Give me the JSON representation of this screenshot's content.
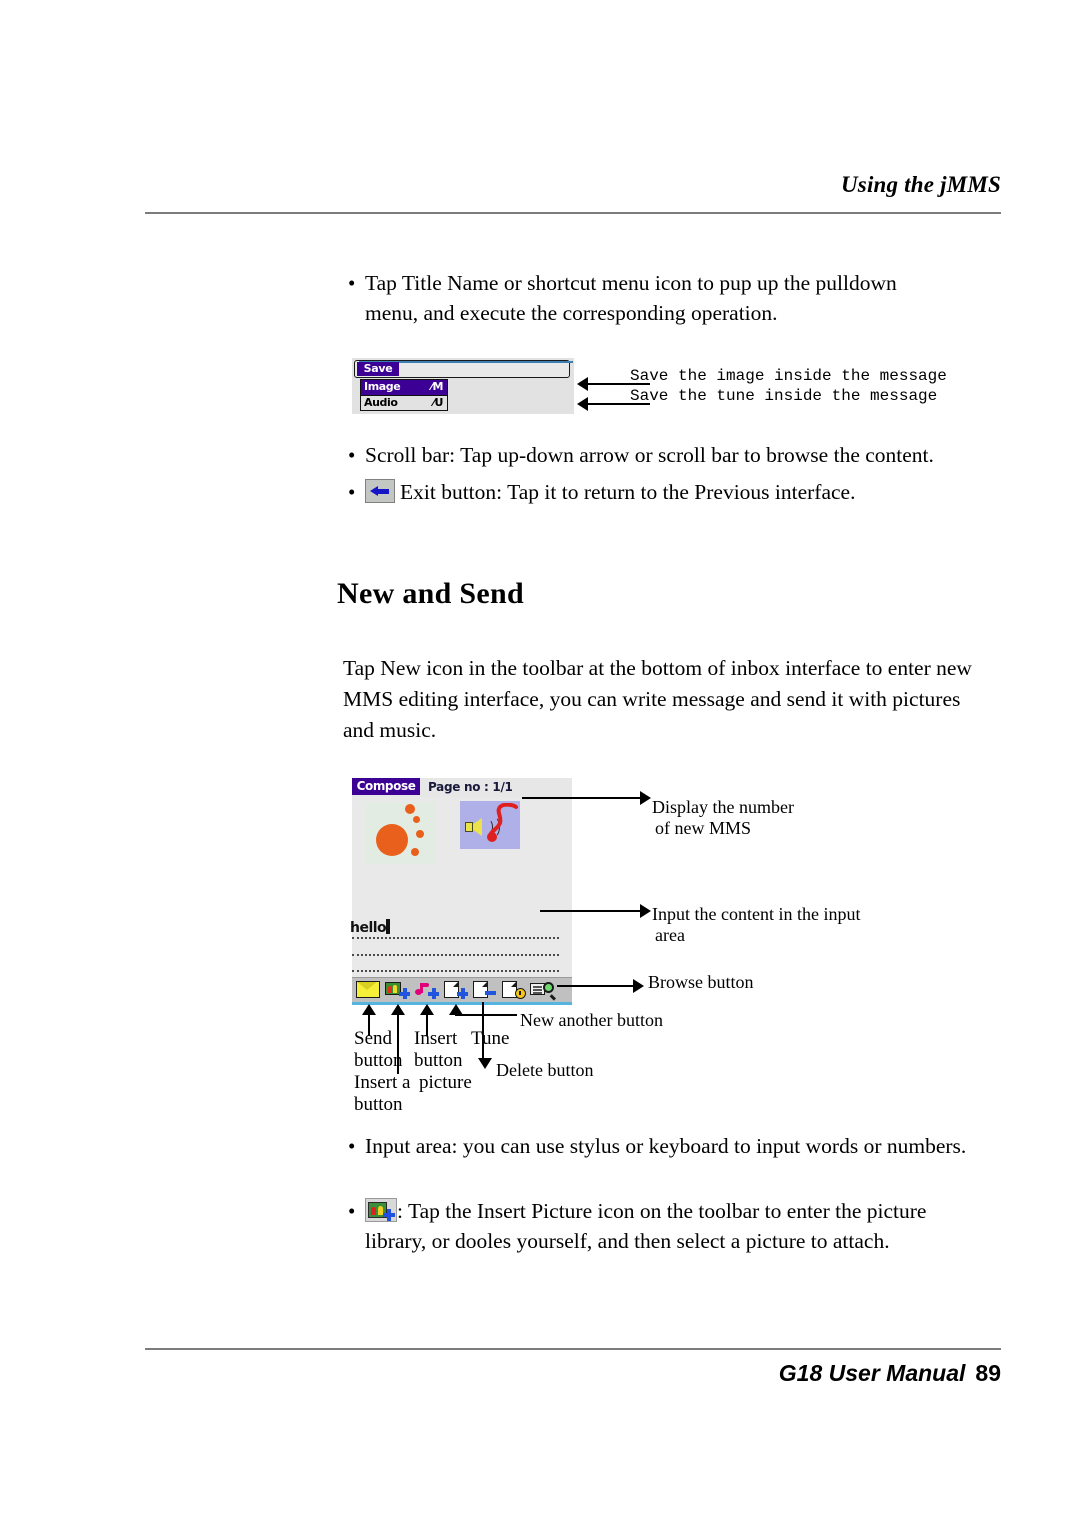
{
  "header": {
    "title": "Using the jMMS"
  },
  "bullets_top": [
    {
      "text": "Tap Title Name or shortcut menu icon to pup up the pulldown menu, and execute the corresponding operation."
    },
    {
      "text": "Scroll bar: Tap up-down arrow or scroll bar to browse the content."
    },
    {
      "text": "Exit button: Tap it to return to the Previous interface.",
      "icon": "exit-back-arrow-icon"
    }
  ],
  "figure_save": {
    "widget": {
      "title_label": "Save",
      "items": [
        {
          "label": "Image",
          "shortcut": "⁄M",
          "selected": true
        },
        {
          "label": "Audio",
          "shortcut": "⁄U",
          "selected": false
        }
      ]
    },
    "annotations": [
      "Save the image inside the message",
      "Save the tune inside the message"
    ]
  },
  "section": {
    "heading": "New and Send",
    "paragraph": "Tap New icon in the toolbar at the bottom of inbox interface to enter new MMS editing interface, you can write message and send it with pictures and music."
  },
  "figure_compose": {
    "device": {
      "title": "Compose",
      "page_no": "Page no : 1/1",
      "input_text": "hello",
      "toolbar_icons": [
        "send-envelope-icon",
        "insert-picture-icon",
        "insert-tune-icon",
        "new-page-icon",
        "delete-page-icon",
        "page-clock-icon",
        "browse-icon"
      ]
    },
    "annotations_right": [
      "Display the number",
      "of new MMS",
      "Input the content in the input",
      "area",
      "Browse button",
      "New another button",
      "Delete button"
    ],
    "captions_below": {
      "col1_line1": "Send",
      "col1_line2": "button",
      "col1_line3": "Insert a",
      "col1_line4": "button",
      "col2_line1": "Insert",
      "col2_line2": "button",
      "col2_line3": "picture",
      "col3_line1": "Tune",
      "new_another": "New another button",
      "delete": "Delete button",
      "browse": "Browse button"
    }
  },
  "bullets_bottom": [
    {
      "text": "Input area: you can use stylus or keyboard to input words or numbers."
    },
    {
      "icon": "insert-picture-icon",
      "text": ": Tap the Insert Picture icon on the toolbar to enter the picture library, or dooles yourself, and then select a picture to attach."
    }
  ],
  "footer": {
    "manual": "G18 User Manual",
    "page": "89"
  }
}
